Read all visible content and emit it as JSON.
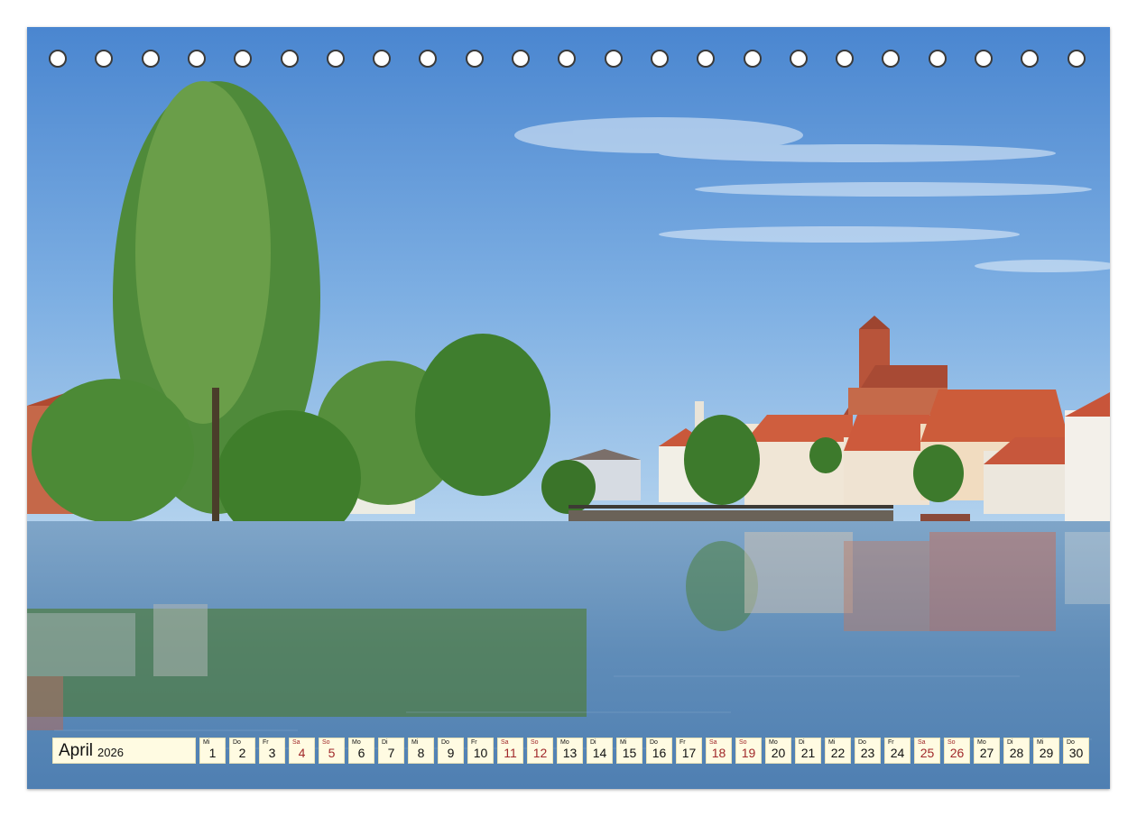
{
  "calendar": {
    "month": "April",
    "year": "2026",
    "days": [
      {
        "wd": "Mi",
        "n": "1",
        "weekend": false
      },
      {
        "wd": "Do",
        "n": "2",
        "weekend": false
      },
      {
        "wd": "Fr",
        "n": "3",
        "weekend": false
      },
      {
        "wd": "Sa",
        "n": "4",
        "weekend": true
      },
      {
        "wd": "So",
        "n": "5",
        "weekend": true
      },
      {
        "wd": "Mo",
        "n": "6",
        "weekend": false
      },
      {
        "wd": "Di",
        "n": "7",
        "weekend": false
      },
      {
        "wd": "Mi",
        "n": "8",
        "weekend": false
      },
      {
        "wd": "Do",
        "n": "9",
        "weekend": false
      },
      {
        "wd": "Fr",
        "n": "10",
        "weekend": false
      },
      {
        "wd": "Sa",
        "n": "11",
        "weekend": true
      },
      {
        "wd": "So",
        "n": "12",
        "weekend": true
      },
      {
        "wd": "Mo",
        "n": "13",
        "weekend": false
      },
      {
        "wd": "Di",
        "n": "14",
        "weekend": false
      },
      {
        "wd": "Mi",
        "n": "15",
        "weekend": false
      },
      {
        "wd": "Do",
        "n": "16",
        "weekend": false
      },
      {
        "wd": "Fr",
        "n": "17",
        "weekend": false
      },
      {
        "wd": "Sa",
        "n": "18",
        "weekend": true
      },
      {
        "wd": "So",
        "n": "19",
        "weekend": true
      },
      {
        "wd": "Mo",
        "n": "20",
        "weekend": false
      },
      {
        "wd": "Di",
        "n": "21",
        "weekend": false
      },
      {
        "wd": "Mi",
        "n": "22",
        "weekend": false
      },
      {
        "wd": "Do",
        "n": "23",
        "weekend": false
      },
      {
        "wd": "Fr",
        "n": "24",
        "weekend": false
      },
      {
        "wd": "Sa",
        "n": "25",
        "weekend": true
      },
      {
        "wd": "So",
        "n": "26",
        "weekend": true
      },
      {
        "wd": "Mo",
        "n": "27",
        "weekend": false
      },
      {
        "wd": "Di",
        "n": "28",
        "weekend": false
      },
      {
        "wd": "Mi",
        "n": "29",
        "weekend": false
      },
      {
        "wd": "Do",
        "n": "30",
        "weekend": false
      }
    ]
  },
  "colors": {
    "cell_background": "#fffbe2",
    "weekend_text": "#a0282a",
    "weekday_text": "#111111",
    "sky": "#5b8fd0",
    "water": "#5e89b4",
    "roof": "#c8553a"
  }
}
